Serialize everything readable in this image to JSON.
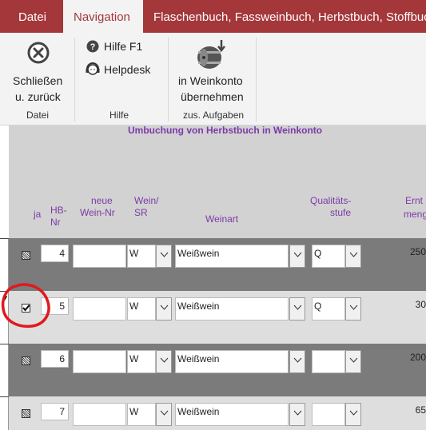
{
  "tabs": [
    {
      "label": "Datei"
    },
    {
      "label": "Navigation"
    },
    {
      "label": "Flaschenbuch, Fassweinbuch, Herbstbuch, Stoffbuch"
    }
  ],
  "ribbon": {
    "close_label_1": "Schließen",
    "close_label_2": "u. zurück",
    "help_label": "Hilfe F1",
    "helpdesk_label": "Helpdesk",
    "transfer_label_1": "in Weinkonto",
    "transfer_label_2": "übernehmen",
    "groups": [
      "Datei",
      "Hilfe",
      "zus. Aufgaben"
    ]
  },
  "grid": {
    "title": "Umbuchung von Herbstbuch in Weinkonto",
    "headers": {
      "ja": "ja",
      "hb_1": "HB-",
      "hb_2": "Nr",
      "neue_1": "neue",
      "neue_2": "Wein-Nr",
      "wein_1": "Wein/",
      "wein_2": "SR",
      "weinart": "Weinart",
      "qual_1": "Qualitäts-",
      "qual_2": "stufe",
      "ernte_1": "Ernt",
      "ernte_2": "meng"
    },
    "rows": [
      {
        "hb": "4",
        "wein": "W",
        "weinart": "Weißwein",
        "qual": "Q",
        "menge": "250"
      },
      {
        "hb": "5",
        "wein": "W",
        "weinart": "Weißwein",
        "qual": "Q",
        "menge": "30"
      },
      {
        "hb": "6",
        "wein": "W",
        "weinart": "Weißwein",
        "qual": "",
        "menge": "200"
      },
      {
        "hb": "7",
        "wein": "W",
        "weinart": "Weißwein",
        "qual": "",
        "menge": "65"
      }
    ]
  },
  "colors": {
    "accent": "#a4373a",
    "header_text": "#7c3aa8",
    "annotation": "#e0191e"
  }
}
